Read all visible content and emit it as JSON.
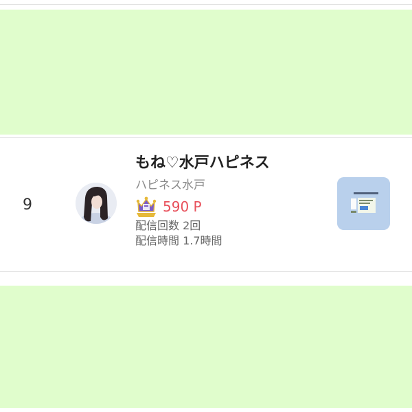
{
  "bands": {
    "color": "#e0fdcc"
  },
  "entry": {
    "rank": "9",
    "name": "もね♡水戸ハピネス",
    "shop": "ハピネス水戸",
    "points": "590 P",
    "delivery_count": "配信回数 2回",
    "delivery_time": "配信時間 1.7時間",
    "avatar_icon": "profile-photo",
    "badge_icon": "crown-badge-icon",
    "thumbnail_icon": "info-card-thumbnail"
  },
  "colors": {
    "points": "#e8505b",
    "thumbnail_bg": "#b9d0ec"
  }
}
